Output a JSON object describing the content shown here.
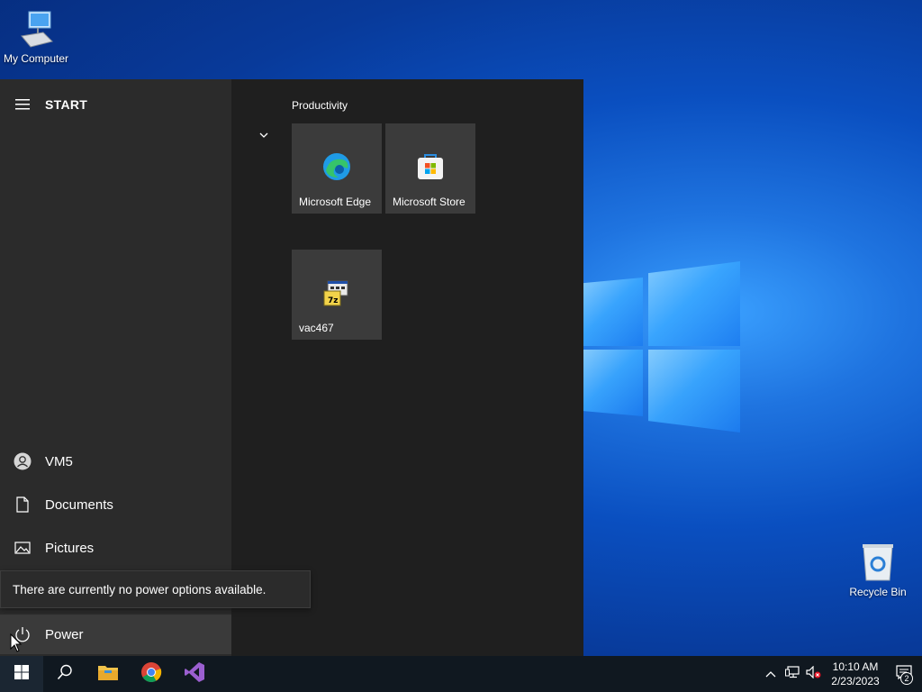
{
  "desktop": {
    "icons": [
      {
        "label": "My Computer",
        "icon": "computer-icon"
      },
      {
        "label": "Recycle Bin",
        "icon": "recycle-bin-icon"
      }
    ]
  },
  "start_menu": {
    "title": "START",
    "left_items": [
      {
        "label": "VM5",
        "icon": "user-icon"
      },
      {
        "label": "Documents",
        "icon": "document-icon"
      },
      {
        "label": "Pictures",
        "icon": "pictures-icon"
      },
      {
        "label": "Power",
        "icon": "power-icon"
      }
    ],
    "tooltip": "There are currently no power options available.",
    "group_title": "Productivity",
    "tiles": [
      {
        "label": "Microsoft Edge",
        "icon": "edge-icon"
      },
      {
        "label": "Microsoft Store",
        "icon": "store-icon"
      },
      {
        "label": "vac467",
        "icon": "7zip-installer-icon"
      }
    ]
  },
  "taskbar": {
    "apps": [
      "start-icon",
      "search-icon",
      "file-explorer-icon",
      "chrome-icon",
      "visual-studio-icon"
    ],
    "tray": {
      "time": "10:10 AM",
      "date": "2/23/2023",
      "notification_count": "2"
    }
  },
  "colors": {
    "start_bg": "#1f1f1f",
    "start_left_bg": "#2b2b2b",
    "tile_bg": "#3b3b3b",
    "taskbar_bg": "#101820",
    "accent": "#0078d7"
  }
}
